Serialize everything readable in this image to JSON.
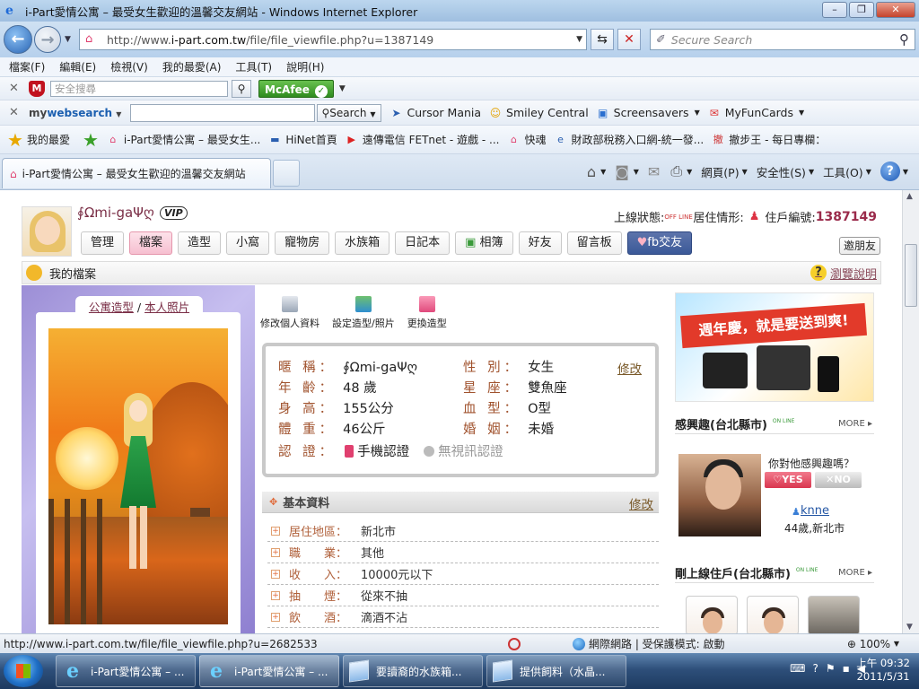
{
  "window": {
    "title": "i-Part愛情公寓 – 最受女生歡迎的溫馨交友網站 - Windows Internet Explorer",
    "min": "–",
    "max": "❐",
    "close": "✕"
  },
  "address": {
    "url_pre": "http://www.",
    "url_domain": "i-part.com.tw",
    "url_post": "/file/file_viewfile.php?u=1387149",
    "search_placeholder": "Secure Search"
  },
  "menu": [
    "檔案(F)",
    "編輯(E)",
    "檢視(V)",
    "我的最愛(A)",
    "工具(T)",
    "說明(H)"
  ],
  "mcafee_toolbar": {
    "search_placeholder": "安全搜尋",
    "brand": "McAfee"
  },
  "mywebsearch": {
    "logo_a": "my",
    "logo_b": "websearch",
    "search_label": "Search",
    "links": [
      "Cursor Mania",
      "Smiley Central",
      "Screensavers",
      "MyFunCards"
    ]
  },
  "favorites": {
    "label": "我的最愛",
    "items": [
      "i-Part愛情公寓 – 最受女生...",
      "HiNet首頁",
      "遠傳電信 FETnet - 遊戲 - ...",
      "快魂",
      "財政部稅務入口網-統一發...",
      "撤步王 - 每日專欄："
    ]
  },
  "tabs": {
    "active": "i-Part愛情公寓 – 最受女生歡迎的溫馨交友網站"
  },
  "commandbar": [
    "網頁(P)",
    "安全性(S)",
    "工具(O)"
  ],
  "profile": {
    "nickname": "∮Ωmi-gaΨღ",
    "vip": "VIP",
    "online_label": "上線狀態:",
    "offline_badge": "OFF LINE",
    "living_label": "居住情形:",
    "resident_label": "住戶編號:",
    "resident_no": "1387149",
    "tabs": [
      "管理",
      "檔案",
      "造型",
      "小窩",
      "寵物房",
      "水族箱",
      "日記本",
      "相簿",
      "好友",
      "留言板",
      "fb交友"
    ],
    "active_tab": "檔案",
    "invite": "邀朋友",
    "section_title": "我的檔案",
    "help": "瀏覽說明",
    "art_tab_a": "公寓造型",
    "art_tab_sep": " / ",
    "art_tab_b": "本人照片",
    "actions": [
      "修改個人資料",
      "設定造型/照片",
      "更換造型"
    ],
    "info": {
      "nick_k": "暱 稱：",
      "nick_v": "∮Ωmi-gaΨღ",
      "gender_k": "性 別：",
      "gender_v": "女生",
      "age_k": "年 齡：",
      "age_v": "48 歲",
      "sign_k": "星 座：",
      "sign_v": "雙魚座",
      "height_k": "身 高：",
      "height_v": "155公分",
      "blood_k": "血 型：",
      "blood_v": "O型",
      "weight_k": "體 重：",
      "weight_v": "46公斤",
      "marital_k": "婚 姻：",
      "marital_v": "未婚",
      "cert_k": "認 證：",
      "cert_phone": "手機認證",
      "cert_video": "無視訊認證",
      "edit": "修改"
    },
    "basic": {
      "title": "基本資料",
      "edit": "修改",
      "rows": [
        {
          "k": "居住地區：",
          "v": "新北市"
        },
        {
          "k": "職　　業：",
          "v": "其他"
        },
        {
          "k": "收　　入：",
          "v": "10000元以下"
        },
        {
          "k": "抽　　煙：",
          "v": "從來不抽"
        },
        {
          "k": "飲　　酒：",
          "v": "滴酒不沾"
        }
      ]
    }
  },
  "sidebar": {
    "ad_text": "週年慶，就是要送到爽!",
    "interest_title": "感興趣(台北縣市)",
    "more": "MORE",
    "question": "你對他感興趣嗎？",
    "yes": "♡YES",
    "no": "✕NO",
    "rec_name": "knne",
    "rec_sub": "44歲,新北市",
    "online_title": "剛上線住戶(台北縣市)",
    "online_badge": "ON LINE"
  },
  "status": {
    "url": "http://www.i-part.com.tw/file/file_viewfile.php?u=2682533",
    "zone": "網際網路 | 受保護模式: 啟動",
    "zoom": "100%"
  },
  "taskbar": {
    "items": [
      "i-Part愛情公寓 – ...",
      "i-Part愛情公寓 – ...",
      "要讀裔的水族箱...",
      "提供飼料（水晶..."
    ],
    "time": "上午 09:32",
    "date": "2011/5/31"
  }
}
